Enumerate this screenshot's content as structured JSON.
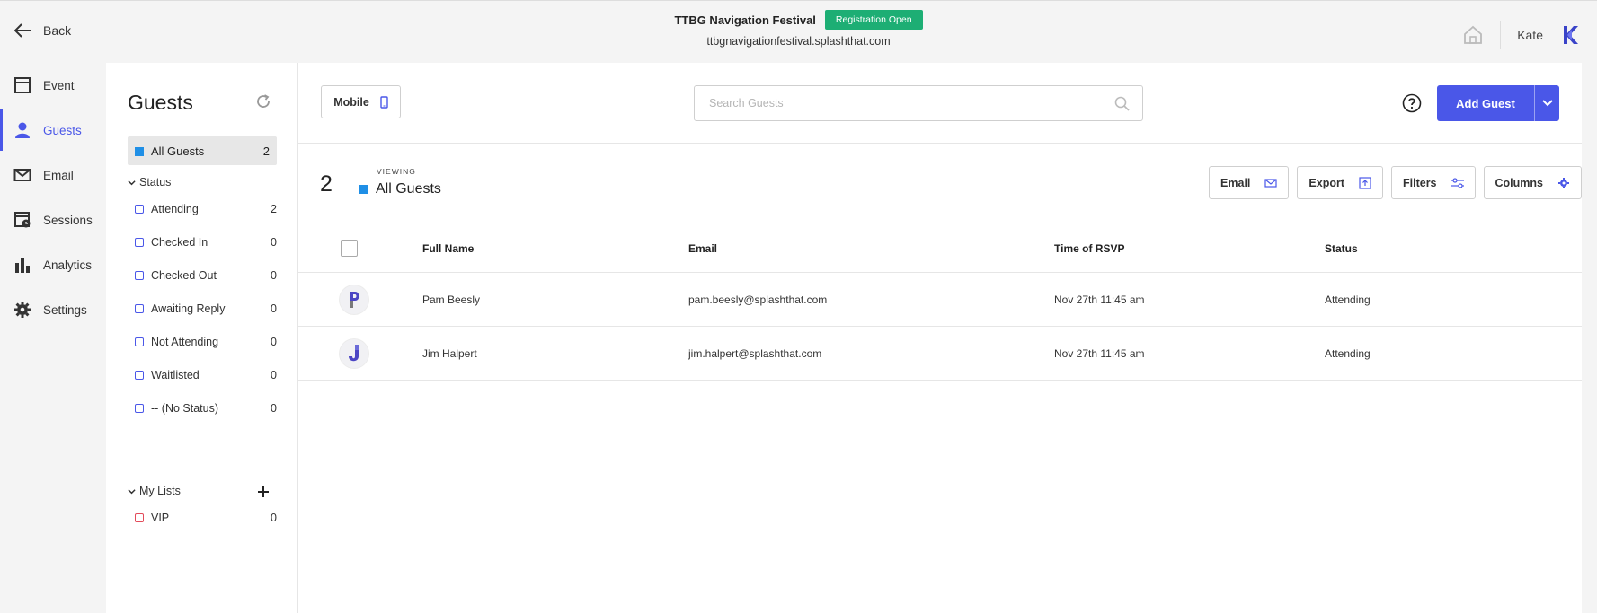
{
  "header": {
    "back_label": "Back",
    "event_title": "TTBG Navigation Festival",
    "status_badge": "Registration Open",
    "event_url": "ttbgnavigationfestival.splashthat.com",
    "user_name": "Kate"
  },
  "nav": {
    "items": [
      {
        "label": "Event",
        "icon": "event-icon"
      },
      {
        "label": "Guests",
        "icon": "guests-icon",
        "active": true
      },
      {
        "label": "Email",
        "icon": "email-icon"
      },
      {
        "label": "Sessions",
        "icon": "sessions-icon"
      },
      {
        "label": "Analytics",
        "icon": "analytics-icon"
      },
      {
        "label": "Settings",
        "icon": "settings-icon"
      }
    ]
  },
  "guests_panel": {
    "title": "Guests",
    "all_guests": {
      "label": "All Guests",
      "count": "2"
    },
    "status_heading": "Status",
    "statuses": [
      {
        "label": "Attending",
        "count": "2"
      },
      {
        "label": "Checked In",
        "count": "0"
      },
      {
        "label": "Checked Out",
        "count": "0"
      },
      {
        "label": "Awaiting Reply",
        "count": "0"
      },
      {
        "label": "Not Attending",
        "count": "0"
      },
      {
        "label": "Waitlisted",
        "count": "0"
      },
      {
        "label": "-- (No Status)",
        "count": "0"
      }
    ],
    "lists_heading": "My Lists",
    "lists": [
      {
        "label": "VIP",
        "count": "0"
      }
    ]
  },
  "toolbar": {
    "mobile_label": "Mobile",
    "search_placeholder": "Search Guests",
    "search_value": "",
    "add_guest_label": "Add Guest"
  },
  "viewbar": {
    "count": "2",
    "viewing_label": "VIEWING",
    "viewing_name": "All Guests",
    "actions": {
      "email": "Email",
      "export": "Export",
      "filters": "Filters",
      "columns": "Columns"
    }
  },
  "table": {
    "columns": [
      "Full Name",
      "Email",
      "Time of RSVP",
      "Status"
    ],
    "rows": [
      {
        "name": "Pam Beesly",
        "email": "pam.beesly@splashthat.com",
        "rsvp": "Nov 27th 11:45 am",
        "status": "Attending",
        "initial_icon": "letter-p-avatar"
      },
      {
        "name": "Jim Halpert",
        "email": "jim.halpert@splashthat.com",
        "rsvp": "Nov 27th 11:45 am",
        "status": "Attending",
        "initial_icon": "letter-j-avatar"
      }
    ]
  },
  "colors": {
    "accent": "#4a57e8",
    "badge_green": "#1dae74",
    "all_guests_square": "#1f8fe6",
    "vip_square": "#e34b5a"
  }
}
